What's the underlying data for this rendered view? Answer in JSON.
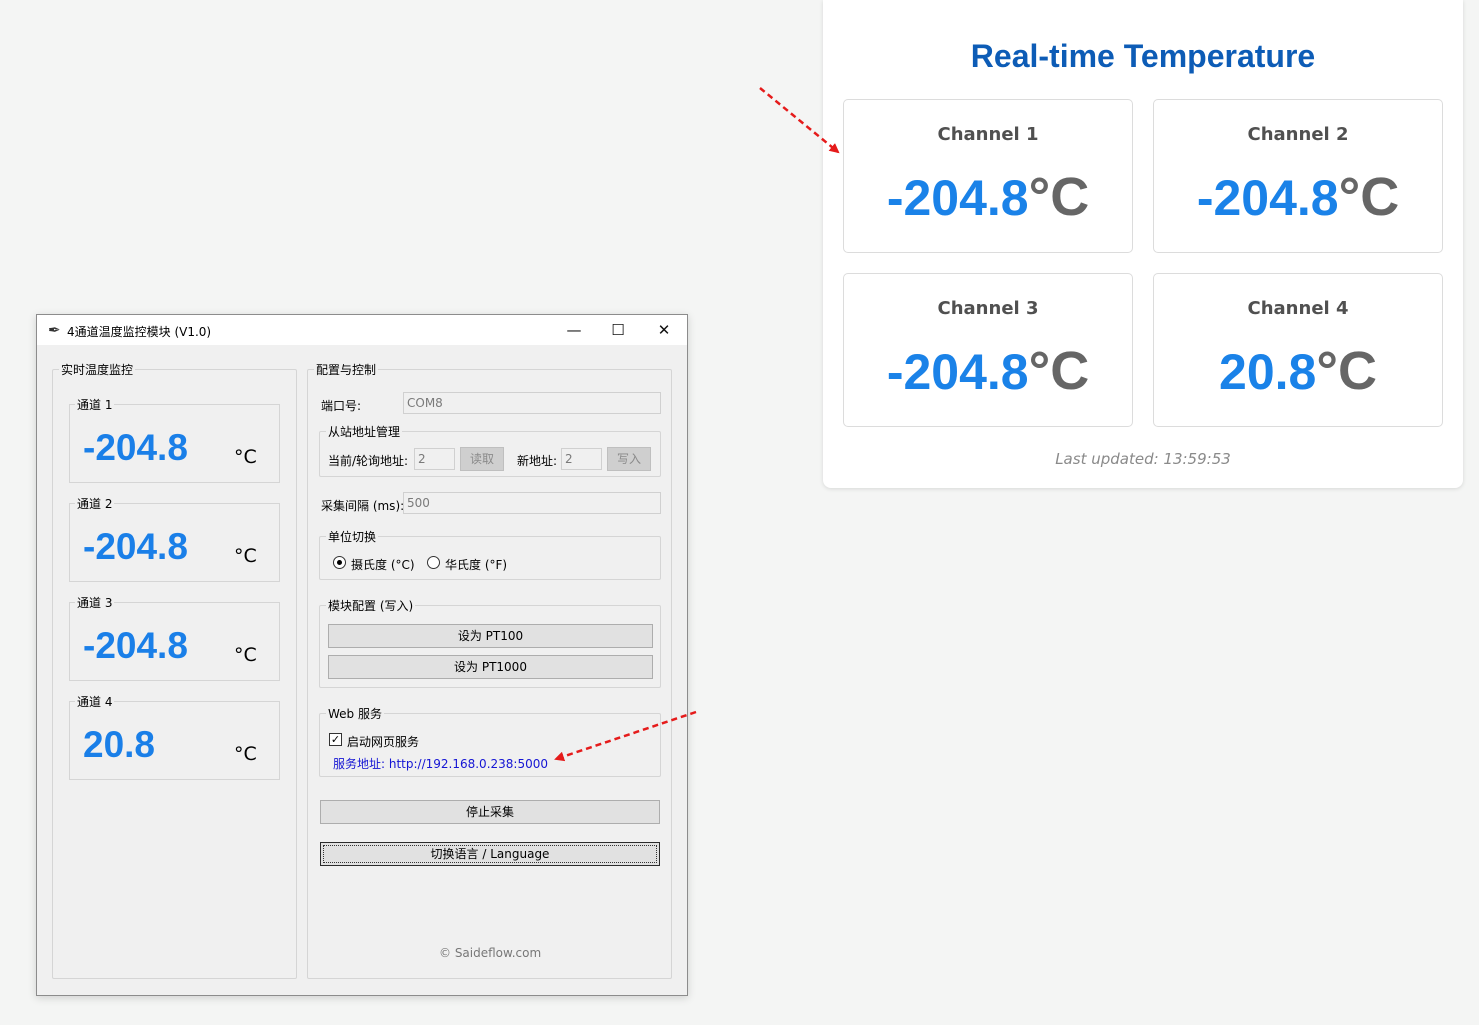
{
  "web": {
    "title": "Real-time Temperature",
    "channels": [
      {
        "name": "Channel 1",
        "value": "-204.8",
        "unit": "°C"
      },
      {
        "name": "Channel 2",
        "value": "-204.8",
        "unit": "°C"
      },
      {
        "name": "Channel 3",
        "value": "-204.8",
        "unit": "°C"
      },
      {
        "name": "Channel 4",
        "value": "20.8",
        "unit": "°C"
      }
    ],
    "last_updated": "Last updated: 13:59:53"
  },
  "window": {
    "title": "4通道温度监控模块 (V1.0)",
    "icon": "feather-icon",
    "controls": {
      "minimize": "—",
      "maximize": "☐",
      "close": "✕"
    },
    "monitor": {
      "label": "实时温度监控",
      "channels": [
        {
          "label": "通道 1",
          "value": "-204.8",
          "unit": "°C"
        },
        {
          "label": "通道 2",
          "value": "-204.8",
          "unit": "°C"
        },
        {
          "label": "通道 3",
          "value": "-204.8",
          "unit": "°C"
        },
        {
          "label": "通道 4",
          "value": "20.8",
          "unit": "°C"
        }
      ]
    },
    "config": {
      "label": "配置与控制",
      "port_label": "端口号:",
      "port_value": "COM8",
      "slave": {
        "label": "从站地址管理",
        "current_label": "当前/轮询地址:",
        "current_value": "2",
        "read_button": "读取",
        "new_label": "新地址:",
        "new_value": "2",
        "write_button": "写入"
      },
      "interval_label": "采集间隔 (ms):",
      "interval_value": "500",
      "unit": {
        "label": "单位切换",
        "celsius": "摄氏度 (°C)",
        "fahrenheit": "华氏度 (°F)",
        "selected": "celsius"
      },
      "module": {
        "label": "模块配置 (写入)",
        "pt100_button": "设为 PT100",
        "pt1000_button": "设为 PT1000"
      },
      "web": {
        "label": "Web 服务",
        "enable_label": "启动网页服务",
        "enabled": true,
        "address": "服务地址: http://192.168.0.238:5000"
      },
      "stop_button": "停止采集",
      "language_button": "切换语言 / Language",
      "copyright": "© Saideflow.com"
    }
  },
  "colors": {
    "accent_blue": "#1a82e8",
    "title_blue": "#0d5cb6",
    "link_blue": "#1515d4",
    "arrow_red": "#e51b1b"
  }
}
